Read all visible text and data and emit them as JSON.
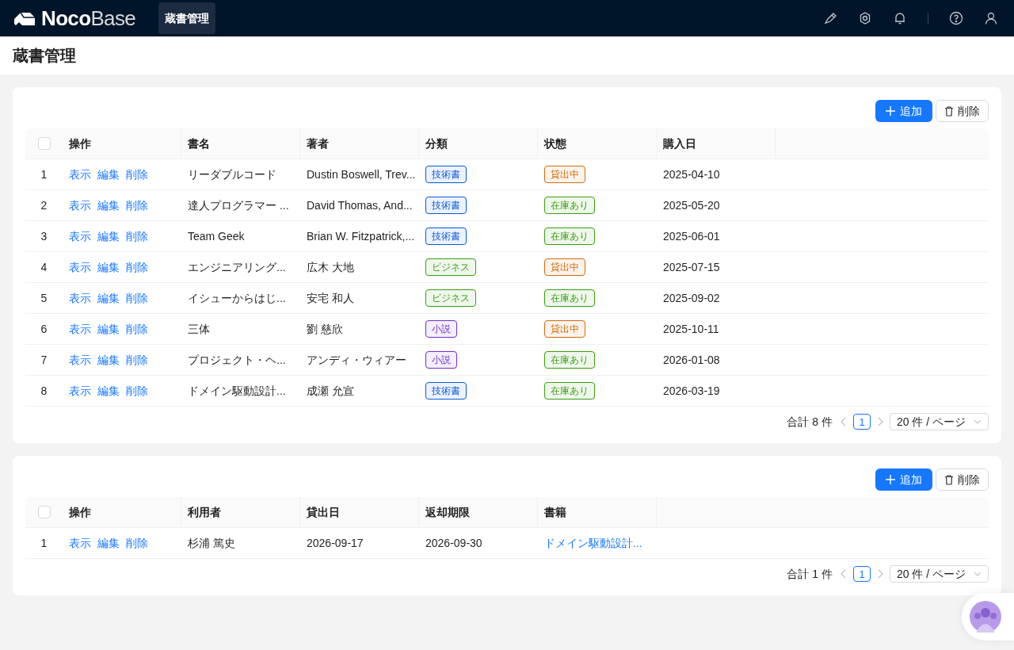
{
  "header": {
    "logo": {
      "bold": "Noco",
      "light": "Base"
    },
    "nav": [
      {
        "label": "蔵書管理",
        "selected": true
      }
    ]
  },
  "page_title": "蔵書管理",
  "blocks": [
    {
      "toolbar": {
        "add": "追加",
        "delete": "削除"
      },
      "columns": [
        {
          "kind": "checkbox",
          "checked": false
        },
        {
          "kind": "label",
          "text": "操作"
        },
        {
          "kind": "label",
          "text": "書名"
        },
        {
          "kind": "label",
          "text": "著者"
        },
        {
          "kind": "label",
          "text": "分類"
        },
        {
          "kind": "label",
          "text": "状態"
        },
        {
          "kind": "label",
          "text": "購入日"
        }
      ],
      "rows": [
        {
          "cells": [
            {
              "kind": "index",
              "text": "1"
            },
            {
              "kind": "actions",
              "links": [
                "表示",
                "編集",
                "削除"
              ]
            },
            {
              "kind": "text",
              "text": "リーダブルコード"
            },
            {
              "kind": "text",
              "text": "Dustin Boswell, Trev..."
            },
            {
              "kind": "tag",
              "text": "技術書",
              "color": "#0958d9"
            },
            {
              "kind": "tag",
              "text": "貸出中",
              "color": "#d46b08"
            },
            {
              "kind": "text",
              "text": "2025-04-10"
            }
          ]
        },
        {
          "cells": [
            {
              "kind": "index",
              "text": "2"
            },
            {
              "kind": "actions",
              "links": [
                "表示",
                "編集",
                "削除"
              ]
            },
            {
              "kind": "text",
              "text": "達人プログラマー ..."
            },
            {
              "kind": "text",
              "text": "David Thomas, And..."
            },
            {
              "kind": "tag",
              "text": "技術書",
              "color": "#0958d9"
            },
            {
              "kind": "tag",
              "text": "在庫あり",
              "color": "#389e0d"
            },
            {
              "kind": "text",
              "text": "2025-05-20"
            }
          ]
        },
        {
          "cells": [
            {
              "kind": "index",
              "text": "3"
            },
            {
              "kind": "actions",
              "links": [
                "表示",
                "編集",
                "削除"
              ]
            },
            {
              "kind": "text",
              "text": "Team Geek"
            },
            {
              "kind": "text",
              "text": "Brian W. Fitzpatrick,..."
            },
            {
              "kind": "tag",
              "text": "技術書",
              "color": "#0958d9"
            },
            {
              "kind": "tag",
              "text": "在庫あり",
              "color": "#389e0d"
            },
            {
              "kind": "text",
              "text": "2025-06-01"
            }
          ]
        },
        {
          "cells": [
            {
              "kind": "index",
              "text": "4"
            },
            {
              "kind": "actions",
              "links": [
                "表示",
                "編集",
                "削除"
              ]
            },
            {
              "kind": "text",
              "text": "エンジニアリング..."
            },
            {
              "kind": "text",
              "text": "広木 大地"
            },
            {
              "kind": "tag",
              "text": "ビジネス",
              "color": "#389e0d"
            },
            {
              "kind": "tag",
              "text": "貸出中",
              "color": "#d46b08"
            },
            {
              "kind": "text",
              "text": "2025-07-15"
            }
          ]
        },
        {
          "cells": [
            {
              "kind": "index",
              "text": "5"
            },
            {
              "kind": "actions",
              "links": [
                "表示",
                "編集",
                "削除"
              ]
            },
            {
              "kind": "text",
              "text": "イシューからはじ..."
            },
            {
              "kind": "text",
              "text": "安宅 和人"
            },
            {
              "kind": "tag",
              "text": "ビジネス",
              "color": "#389e0d"
            },
            {
              "kind": "tag",
              "text": "在庫あり",
              "color": "#389e0d"
            },
            {
              "kind": "text",
              "text": "2025-09-02"
            }
          ]
        },
        {
          "cells": [
            {
              "kind": "index",
              "text": "6"
            },
            {
              "kind": "actions",
              "links": [
                "表示",
                "編集",
                "削除"
              ]
            },
            {
              "kind": "text",
              "text": "三体"
            },
            {
              "kind": "text",
              "text": "劉 慈欣"
            },
            {
              "kind": "tag",
              "text": "小説",
              "color": "#722ed1"
            },
            {
              "kind": "tag",
              "text": "貸出中",
              "color": "#d46b08"
            },
            {
              "kind": "text",
              "text": "2025-10-11"
            }
          ]
        },
        {
          "cells": [
            {
              "kind": "index",
              "text": "7"
            },
            {
              "kind": "actions",
              "links": [
                "表示",
                "編集",
                "削除"
              ]
            },
            {
              "kind": "text",
              "text": "プロジェクト・ヘ..."
            },
            {
              "kind": "text",
              "text": "アンディ・ウィアー"
            },
            {
              "kind": "tag",
              "text": "小説",
              "color": "#722ed1"
            },
            {
              "kind": "tag",
              "text": "在庫あり",
              "color": "#389e0d"
            },
            {
              "kind": "text",
              "text": "2026-01-08"
            }
          ]
        },
        {
          "cells": [
            {
              "kind": "index",
              "text": "8"
            },
            {
              "kind": "actions",
              "links": [
                "表示",
                "編集",
                "削除"
              ]
            },
            {
              "kind": "text",
              "text": "ドメイン駆動設計..."
            },
            {
              "kind": "text",
              "text": "成瀬 允宣"
            },
            {
              "kind": "tag",
              "text": "技術書",
              "color": "#0958d9"
            },
            {
              "kind": "tag",
              "text": "在庫あり",
              "color": "#389e0d"
            },
            {
              "kind": "text",
              "text": "2026-03-19"
            }
          ]
        }
      ],
      "pagination": {
        "total": "合計 8 件",
        "page": "1",
        "page_size": "20 件 / ページ"
      }
    },
    {
      "toolbar": {
        "add": "追加",
        "delete": "削除"
      },
      "columns": [
        {
          "kind": "checkbox",
          "checked": false
        },
        {
          "kind": "label",
          "text": "操作"
        },
        {
          "kind": "label",
          "text": "利用者"
        },
        {
          "kind": "label",
          "text": "貸出日"
        },
        {
          "kind": "label",
          "text": "返却期限"
        },
        {
          "kind": "label",
          "text": "書籍"
        }
      ],
      "rows": [
        {
          "cells": [
            {
              "kind": "index",
              "text": "1"
            },
            {
              "kind": "actions",
              "links": [
                "表示",
                "編集",
                "削除"
              ]
            },
            {
              "kind": "text",
              "text": "杉浦 篤史"
            },
            {
              "kind": "text",
              "text": "2026-09-17"
            },
            {
              "kind": "text",
              "text": "2026-09-30"
            },
            {
              "kind": "link",
              "text": "ドメイン駆動設計..."
            }
          ]
        }
      ],
      "pagination": {
        "total": "合計 1 件",
        "page": "1",
        "page_size": "20 件 / ページ"
      }
    }
  ]
}
